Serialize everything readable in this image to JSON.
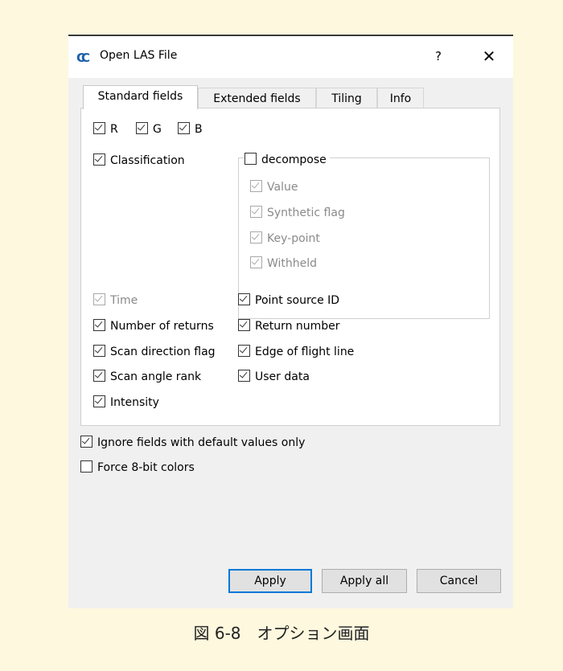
{
  "dialog": {
    "title": "Open LAS File",
    "icon": "cc-logo-icon",
    "help_label": "?",
    "close_label": "✕"
  },
  "tabs": [
    {
      "label": "Standard fields",
      "active": true
    },
    {
      "label": "Extended fields",
      "active": false
    },
    {
      "label": "Tiling",
      "active": false
    },
    {
      "label": "Info",
      "active": false
    }
  ],
  "standard_fields": {
    "r": {
      "label": "R",
      "checked": true
    },
    "g": {
      "label": "G",
      "checked": true
    },
    "b": {
      "label": "B",
      "checked": true
    },
    "classification": {
      "label": "Classification",
      "checked": true
    },
    "decompose": {
      "label": "decompose",
      "checked": false,
      "items": [
        {
          "label": "Value",
          "checked": true,
          "enabled": false
        },
        {
          "label": "Synthetic flag",
          "checked": true,
          "enabled": false
        },
        {
          "label": "Key-point",
          "checked": true,
          "enabled": false
        },
        {
          "label": "Withheld",
          "checked": true,
          "enabled": false
        }
      ]
    },
    "time": {
      "label": "Time",
      "checked": true,
      "enabled": false
    },
    "number_of_returns": {
      "label": "Number of returns",
      "checked": true
    },
    "scan_direction_flag": {
      "label": "Scan direction flag",
      "checked": true
    },
    "scan_angle_rank": {
      "label": "Scan angle rank",
      "checked": true
    },
    "intensity": {
      "label": "Intensity",
      "checked": true
    },
    "point_source_id": {
      "label": "Point source ID",
      "checked": true
    },
    "return_number": {
      "label": "Return number",
      "checked": true
    },
    "edge_of_flight_line": {
      "label": "Edge of flight line",
      "checked": true
    },
    "user_data": {
      "label": "User data",
      "checked": true
    }
  },
  "options": {
    "ignore_default": {
      "label": "Ignore fields with default values only",
      "checked": true
    },
    "force_8bit": {
      "label": "Force 8-bit colors",
      "checked": false
    }
  },
  "buttons": {
    "apply": "Apply",
    "apply_all": "Apply all",
    "cancel": "Cancel"
  },
  "caption": "図 6-8　オプション画面",
  "colors": {
    "page_background": "#fdf8de",
    "dialog_background": "#f0f0f0",
    "default_button_border": "#0078d7"
  }
}
